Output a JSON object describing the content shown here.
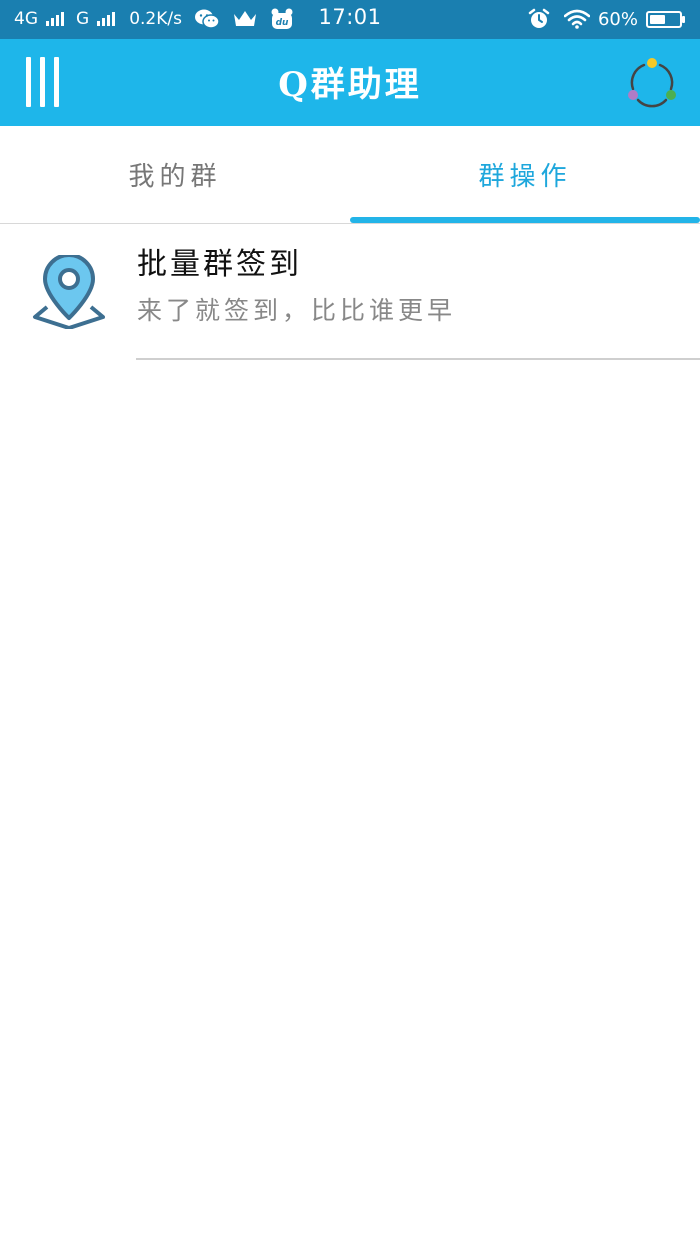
{
  "status_bar": {
    "network_1": "4G",
    "network_2": "G",
    "speed": "0.2K/s",
    "time": "17:01",
    "battery_percent": "60%",
    "battery_level": 0.6,
    "icons": [
      "signal-icon",
      "wechat-icon",
      "crown-icon",
      "baidu-du-icon",
      "alarm-icon",
      "wifi-icon",
      "battery-icon"
    ]
  },
  "app_bar": {
    "title": "Q群助理",
    "background": "#1eb6ea"
  },
  "tabs": [
    {
      "label": "我的群",
      "active": false
    },
    {
      "label": "群操作",
      "active": true
    }
  ],
  "list": {
    "items": [
      {
        "icon": "map-pin-icon",
        "title": "批量群签到",
        "subtitle": "来了就签到，比比谁更早"
      }
    ]
  },
  "colors": {
    "status_bar": "#1a7fb0",
    "accent": "#1eb6ea",
    "active_tab_text": "#1ea7dc",
    "pin_fill": "#6cc7ef",
    "pin_stroke": "#3d6f91"
  }
}
